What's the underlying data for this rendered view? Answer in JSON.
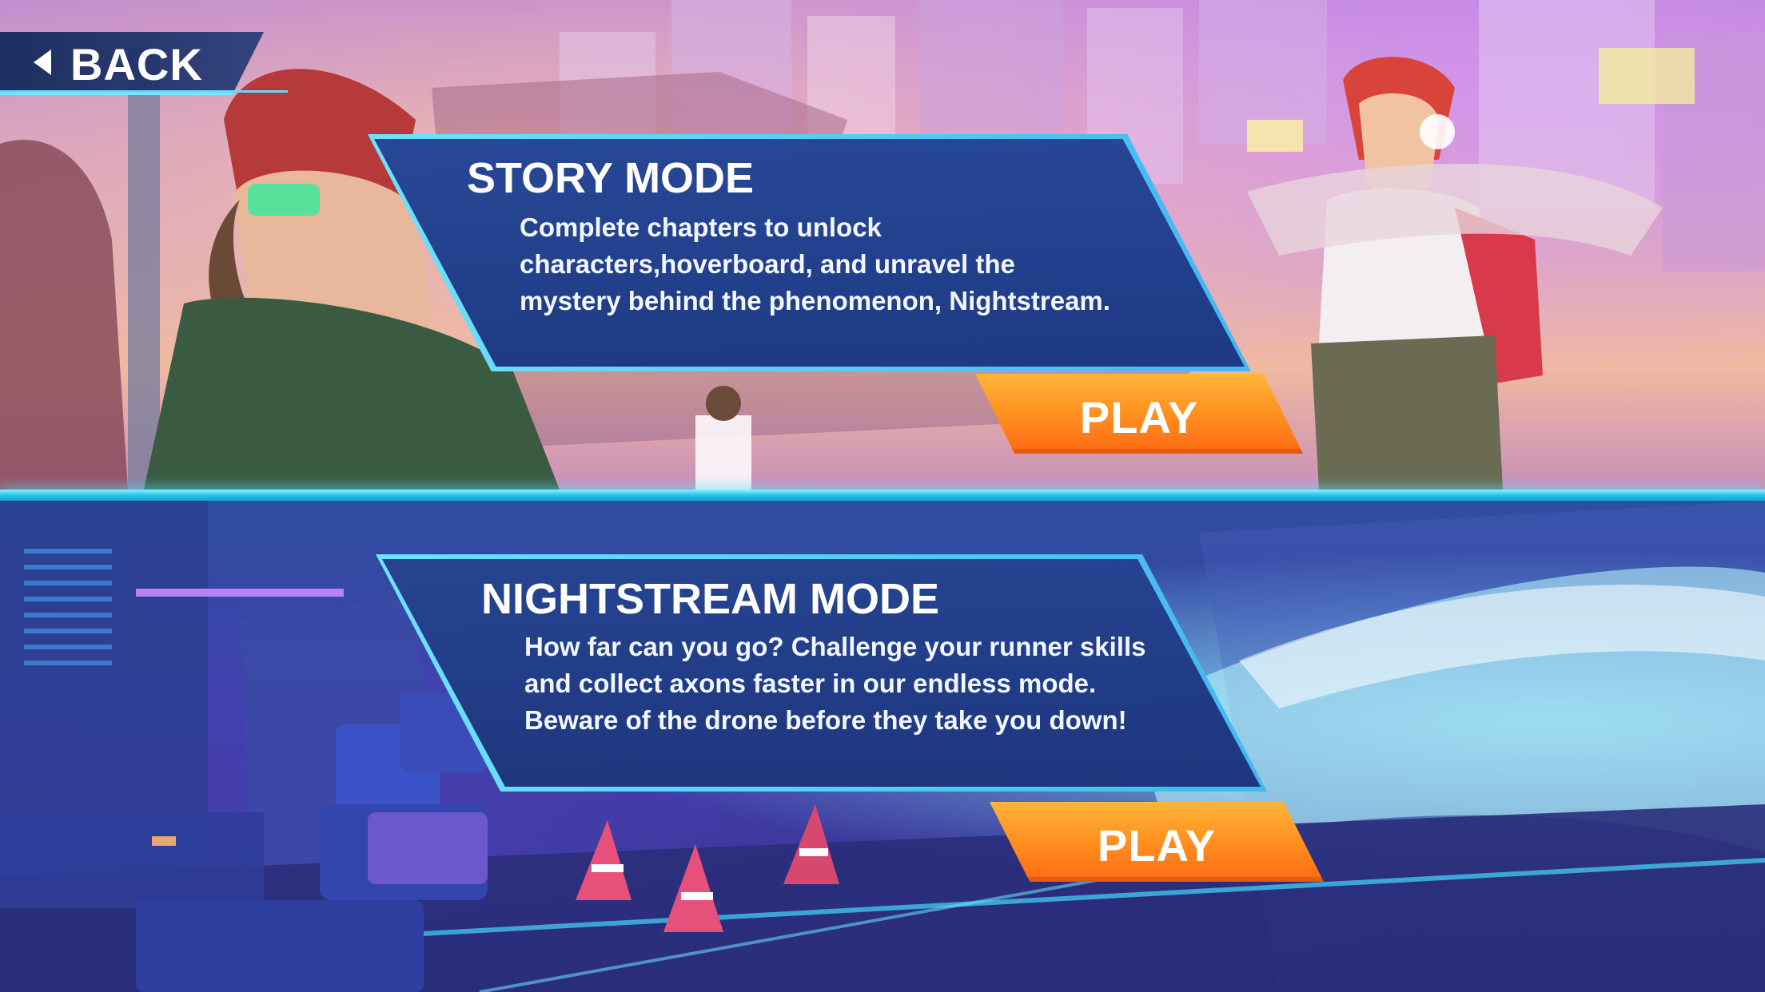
{
  "nav": {
    "back_label": "BACK"
  },
  "story_mode": {
    "title": "STORY MODE",
    "description_lines": [
      "Complete chapters to unlock",
      "characters,hoverboard, and unravel the",
      "mystery behind the phenomenon, Nightstream."
    ],
    "play_label": "PLAY"
  },
  "nightstream_mode": {
    "title": "NIGHTSTREAM MODE",
    "description_lines": [
      "How far can you go? Challenge your runner skills",
      "and collect axons faster in our endless mode.",
      "Beware of the drone before they take you down!"
    ],
    "play_label": "PLAY"
  },
  "colors": {
    "card_fill": "#25428f",
    "card_border": "#6fe2ff",
    "play_button": "#ff8c1e",
    "divider": "#26c4e8"
  },
  "icons": {
    "back": "caret-left-icon"
  }
}
